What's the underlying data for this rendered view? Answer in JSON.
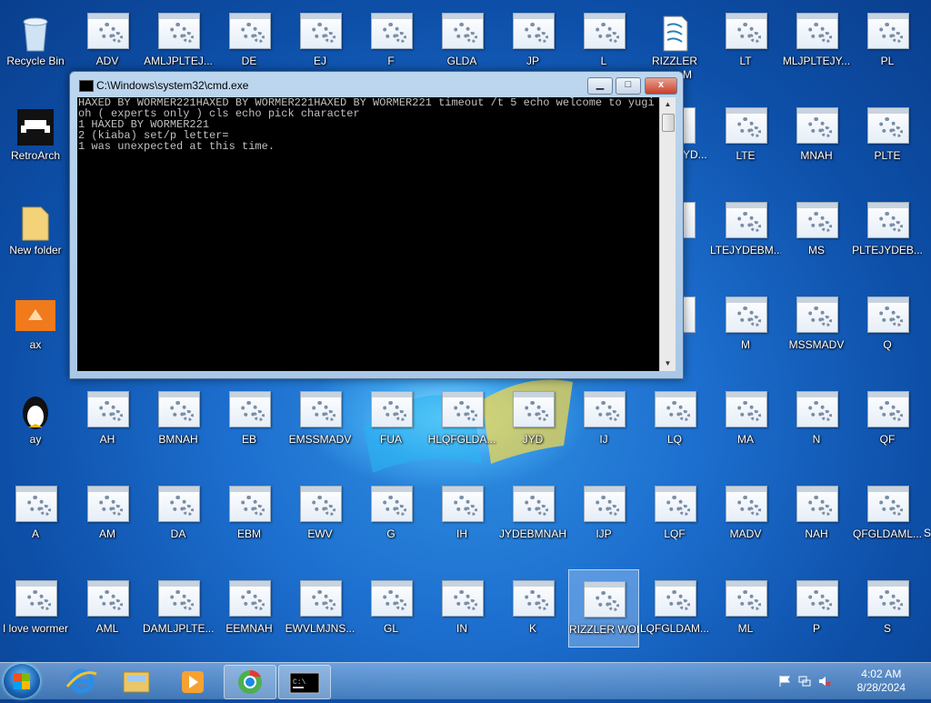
{
  "desktop": {
    "left_icons": [
      {
        "label": "Recycle Bin",
        "icon": "recycle-bin-icon"
      },
      {
        "label": "RetroArch",
        "icon": "retroarch-icon"
      },
      {
        "label": "New folder",
        "icon": "folder-icon"
      },
      {
        "label": "ax",
        "icon": "app-icon"
      },
      {
        "label": "ay",
        "icon": "linux-penguin-icon"
      },
      {
        "label": "A",
        "icon": "batch-file-icon"
      },
      {
        "label": "I love wormer",
        "icon": "batch-file-icon"
      }
    ],
    "row1": [
      "ADV",
      "AMLJPLTEJ...",
      "DE",
      "EJ",
      "F",
      "GLDA",
      "JP",
      "L",
      "RIZZLER",
      "LT",
      "MLJPLTEJY...",
      "PL"
    ],
    "row2": [
      "LTE",
      "MNAH",
      "PLTE"
    ],
    "row3": [
      "LTEJYDEBM...",
      "MS",
      "PLTEJYDEB..."
    ],
    "row4": [
      "M",
      "MSSMADV",
      "Q"
    ],
    "row5": [
      "AH",
      "BMNAH",
      "EB",
      "EMSSMADV",
      "FUA",
      "HLQFGLDA...",
      "JYD",
      "IJ",
      "LQ",
      "MA",
      "N",
      "QF"
    ],
    "row6": [
      "AM",
      "DA",
      "EBM",
      "EWV",
      "G",
      "IH",
      "JYDEBMNAH",
      "IJP",
      "LQF",
      "MADV",
      "NAH",
      "QFGLDAML..."
    ],
    "row7": [
      "AML",
      "DAMLJPLTE...",
      "EEMNAH",
      "EWVLMJNS...",
      "GL",
      "IN",
      "K",
      "RIZZLER WORM",
      "LQFGLDAM...",
      "ML",
      "P",
      "S"
    ],
    "partial_labels": {
      "rizzler_suffix": "M",
      "yd_partial": "YD...",
      "row6_edge": "S"
    }
  },
  "cmd_window": {
    "title": "C:\\Windows\\system32\\cmd.exe",
    "minimize_label": "▁",
    "maximize_label": "□",
    "close_label": "x",
    "console_text": "HAXED BY WORMER221HAXED BY WORMER221HAXED BY WORMER221 timeout /t 5 echo welcome to yugioh ( experts only ) cls echo pick character\n1 HAXED BY WORMER221\n2 (kiaba) set/p letter=\n1 was unexpected at this time."
  },
  "taskbar": {
    "start_label": "Start",
    "apps": [
      {
        "name": "internet-explorer-icon"
      },
      {
        "name": "file-explorer-icon"
      },
      {
        "name": "media-player-icon"
      },
      {
        "name": "chrome-icon"
      },
      {
        "name": "cmd-icon"
      }
    ],
    "clock_time": "4:02 AM",
    "clock_date": "8/28/2024"
  },
  "colors": {
    "desktop": "#1d6fcf",
    "taskbar": "#5a8cbe",
    "console_bg": "#000000",
    "console_fg": "#c0c0c0"
  }
}
